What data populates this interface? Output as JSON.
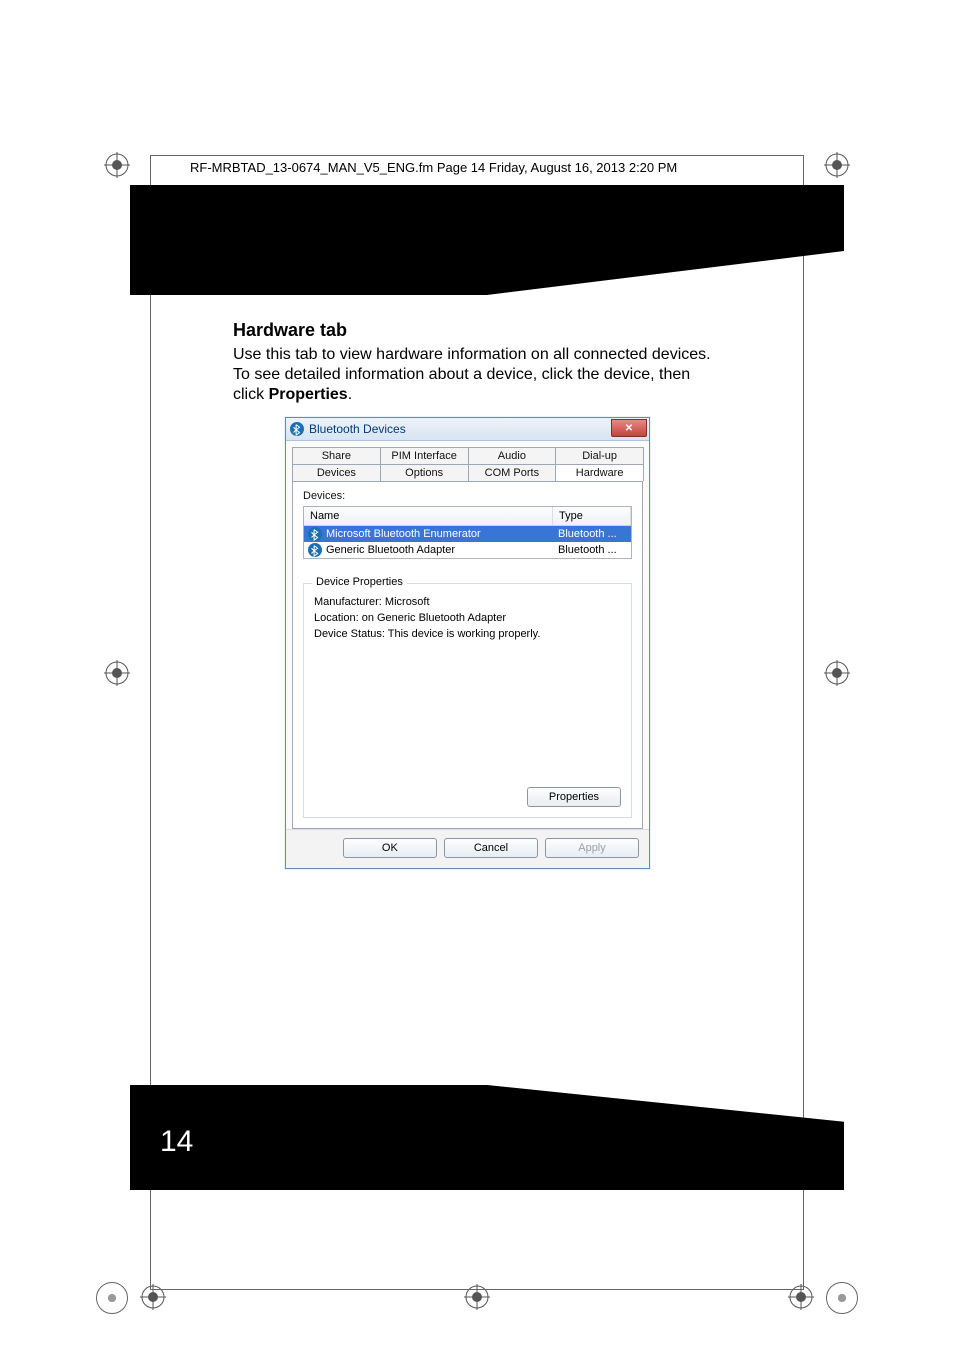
{
  "page": {
    "fm_header": "RF-MRBTAD_13-0674_MAN_V5_ENG.fm  Page 14  Friday, August 16, 2013  2:20 PM",
    "number": "14",
    "heading": "Hardware tab",
    "paragraph_before_bold": "Use this tab to view hardware information on all connected devices. To see detailed information about a device, click the device, then click ",
    "paragraph_bold": "Properties",
    "paragraph_after_bold": "."
  },
  "win": {
    "title": "Bluetooth Devices",
    "close_glyph": "✕",
    "tabs_top": [
      "Share",
      "PIM Interface",
      "Audio",
      "Dial-up"
    ],
    "tabs_bot": [
      "Devices",
      "Options",
      "COM Ports",
      "Hardware"
    ],
    "active_tab_index_bot": 3,
    "devices_label": "Devices:",
    "table_headers": {
      "name": "Name",
      "type": "Type"
    },
    "rows": [
      {
        "name": "Microsoft Bluetooth Enumerator",
        "type": "Bluetooth ...",
        "selected": true
      },
      {
        "name": "Generic Bluetooth Adapter",
        "type": "Bluetooth ...",
        "selected": false
      }
    ],
    "group_legend": "Device Properties",
    "group_lines": [
      "Manufacturer: Microsoft",
      "Location: on Generic Bluetooth Adapter",
      "Device Status: This device is working properly."
    ],
    "properties_btn": "Properties",
    "ok_btn": "OK",
    "cancel_btn": "Cancel",
    "apply_btn": "Apply"
  }
}
